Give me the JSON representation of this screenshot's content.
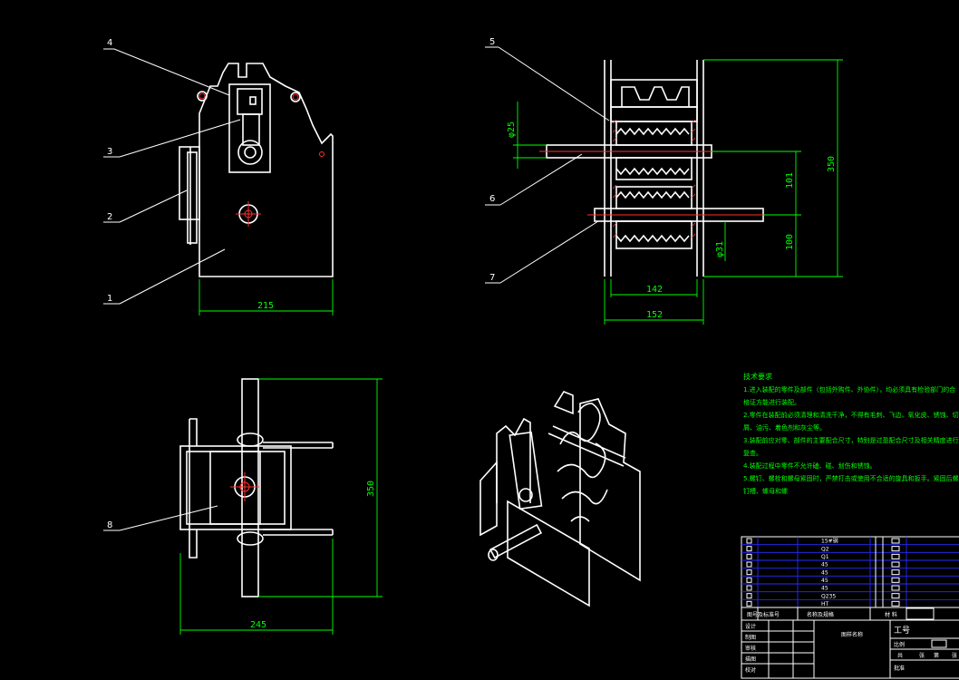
{
  "part_labels": [
    "4",
    "3",
    "2",
    "1",
    "5",
    "6",
    "7",
    "8"
  ],
  "dimensions": {
    "front_width": "215",
    "section_inner_width": "142",
    "section_outer_width": "152",
    "section_height": "350",
    "section_upper_spacing": "101",
    "section_lower_spacing": "100",
    "upper_shaft_dia": "φ25",
    "lower_shaft_dia": "φ31",
    "top_view_height": "350",
    "top_view_width": "245"
  },
  "notes": {
    "title": "技术要求",
    "lines": [
      "1.进入装配的零件及部件（包括外购件、外协件），均必须具有检验部门的合",
      "格证方能进行装配。",
      "2.零件在装配前必须清理和清洗干净，不得有毛刺、飞边、氧化皮、锈蚀、切",
      "屑、油污、着色剂和灰尘等。",
      "3.装配前应对零、部件的主要配合尺寸，特别是过盈配合尺寸及相关精度进行",
      "复查。",
      "4.装配过程中零件不允许磕、碰、划伤和锈蚀。",
      "5.螺钉、螺栓和螺母紧固时，严禁打击或使用不合适的旋具和扳手。紧固后螺",
      "钉槽、螺母和螺"
    ]
  },
  "title_block": {
    "bom_rows": [
      "15#钢",
      "Q2",
      "Q1",
      "45",
      "45",
      "45",
      "45",
      "Q235",
      "HT"
    ],
    "header_left": "图号及标准号",
    "header_mid": "名称及规格",
    "header_material": "材  料",
    "drawing_name": "图样名称",
    "sign_rows": [
      "设计",
      "制图",
      "审核",
      "描图",
      "校对"
    ],
    "project_no": "工号",
    "scale_label": "比例",
    "sheet_labels": [
      "共",
      "张",
      "第",
      "张"
    ],
    "approve": "批准"
  },
  "colors": {
    "background": "#000000",
    "outline": "#ffffff",
    "dimension": "#00ff00",
    "centerline": "#ff3030",
    "table": "#2b2bff"
  }
}
